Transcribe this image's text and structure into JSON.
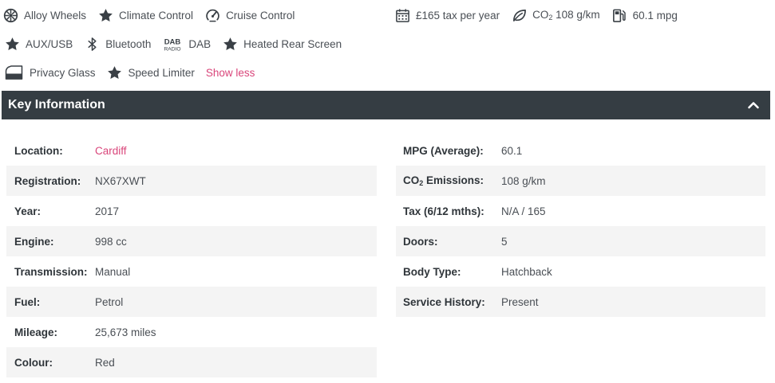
{
  "features": {
    "row1": [
      {
        "icon": "wheel-icon",
        "label": "Alloy Wheels"
      },
      {
        "icon": "star-icon",
        "label": "Climate Control"
      },
      {
        "icon": "speedometer-icon",
        "label": "Cruise Control"
      }
    ],
    "row2": [
      {
        "icon": "star-icon",
        "label": "AUX/USB"
      },
      {
        "icon": "bluetooth-icon",
        "label": "Bluetooth"
      },
      {
        "icon": "dab-radio-icon",
        "label": "DAB"
      },
      {
        "icon": "star-icon",
        "label": "Heated Rear Screen"
      }
    ],
    "row3": [
      {
        "icon": "window-icon",
        "label": "Privacy Glass"
      },
      {
        "icon": "star-icon",
        "label": "Speed Limiter"
      }
    ],
    "show_less": "Show less"
  },
  "summary": {
    "tax": "£165 tax per year",
    "co2_prefix": "CO",
    "co2_sub": "2",
    "co2_value": " 108 g/km",
    "mpg": "60.1 mpg"
  },
  "key_info": {
    "title": "Key Information",
    "left": [
      {
        "label": "Location:",
        "value": "Cardiff"
      },
      {
        "label": "Registration:",
        "value": "NX67XWT"
      },
      {
        "label": "Year:",
        "value": "2017"
      },
      {
        "label": "Engine:",
        "value": "998 cc"
      },
      {
        "label": "Transmission:",
        "value": "Manual"
      },
      {
        "label": "Fuel:",
        "value": "Petrol"
      },
      {
        "label": "Mileage:",
        "value": "25,673 miles"
      },
      {
        "label": "Colour:",
        "value": "Red"
      }
    ],
    "right": [
      {
        "label": "MPG (Average):",
        "value": "60.1"
      },
      {
        "label_prefix": "CO",
        "label_sub": "2",
        "label_suffix": " Emissions:",
        "value": "108 g/km"
      },
      {
        "label": "Tax (6/12 mths):",
        "value": "N/A / 165"
      },
      {
        "label": "Doors:",
        "value": "5"
      },
      {
        "label": "Body Type:",
        "value": "Hatchback"
      },
      {
        "label": "Service History:",
        "value": "Present"
      }
    ]
  },
  "colors": {
    "accent": "#d9457a",
    "header_bg": "#353d43",
    "row_shade": "#f4f4f4"
  }
}
